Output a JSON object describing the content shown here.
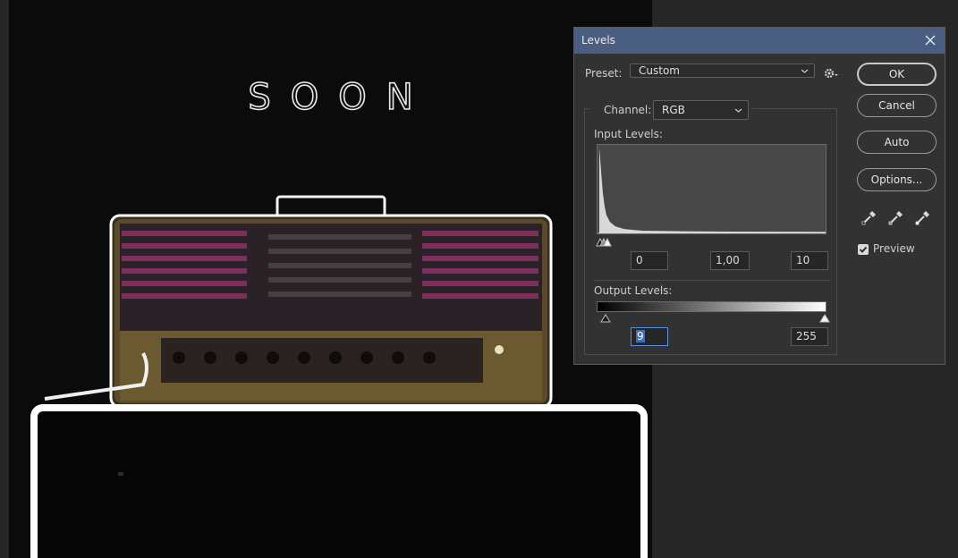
{
  "canvas": {
    "text": "SOON"
  },
  "dialog": {
    "title": "Levels",
    "preset_label": "Preset:",
    "preset_value": "Custom",
    "channel_label": "Channel:",
    "channel_value": "RGB",
    "input_levels_label": "Input Levels:",
    "input_black": "0",
    "input_gamma": "1,00",
    "input_white": "10",
    "output_levels_label": "Output Levels:",
    "output_black": "9",
    "output_white": "255",
    "buttons": {
      "ok": "OK",
      "cancel": "Cancel",
      "auto": "Auto",
      "options": "Options..."
    },
    "preview_label": "Preview",
    "preview_checked": true
  },
  "icons": {
    "close": "close-icon",
    "gear": "gear-icon",
    "eyedroppers": [
      "black-point-eyedropper-icon",
      "gray-point-eyedropper-icon",
      "white-point-eyedropper-icon"
    ]
  },
  "colors": {
    "titlebar": "#4a5e82",
    "dialog_bg": "#323232",
    "focus": "#5b8fd9"
  }
}
